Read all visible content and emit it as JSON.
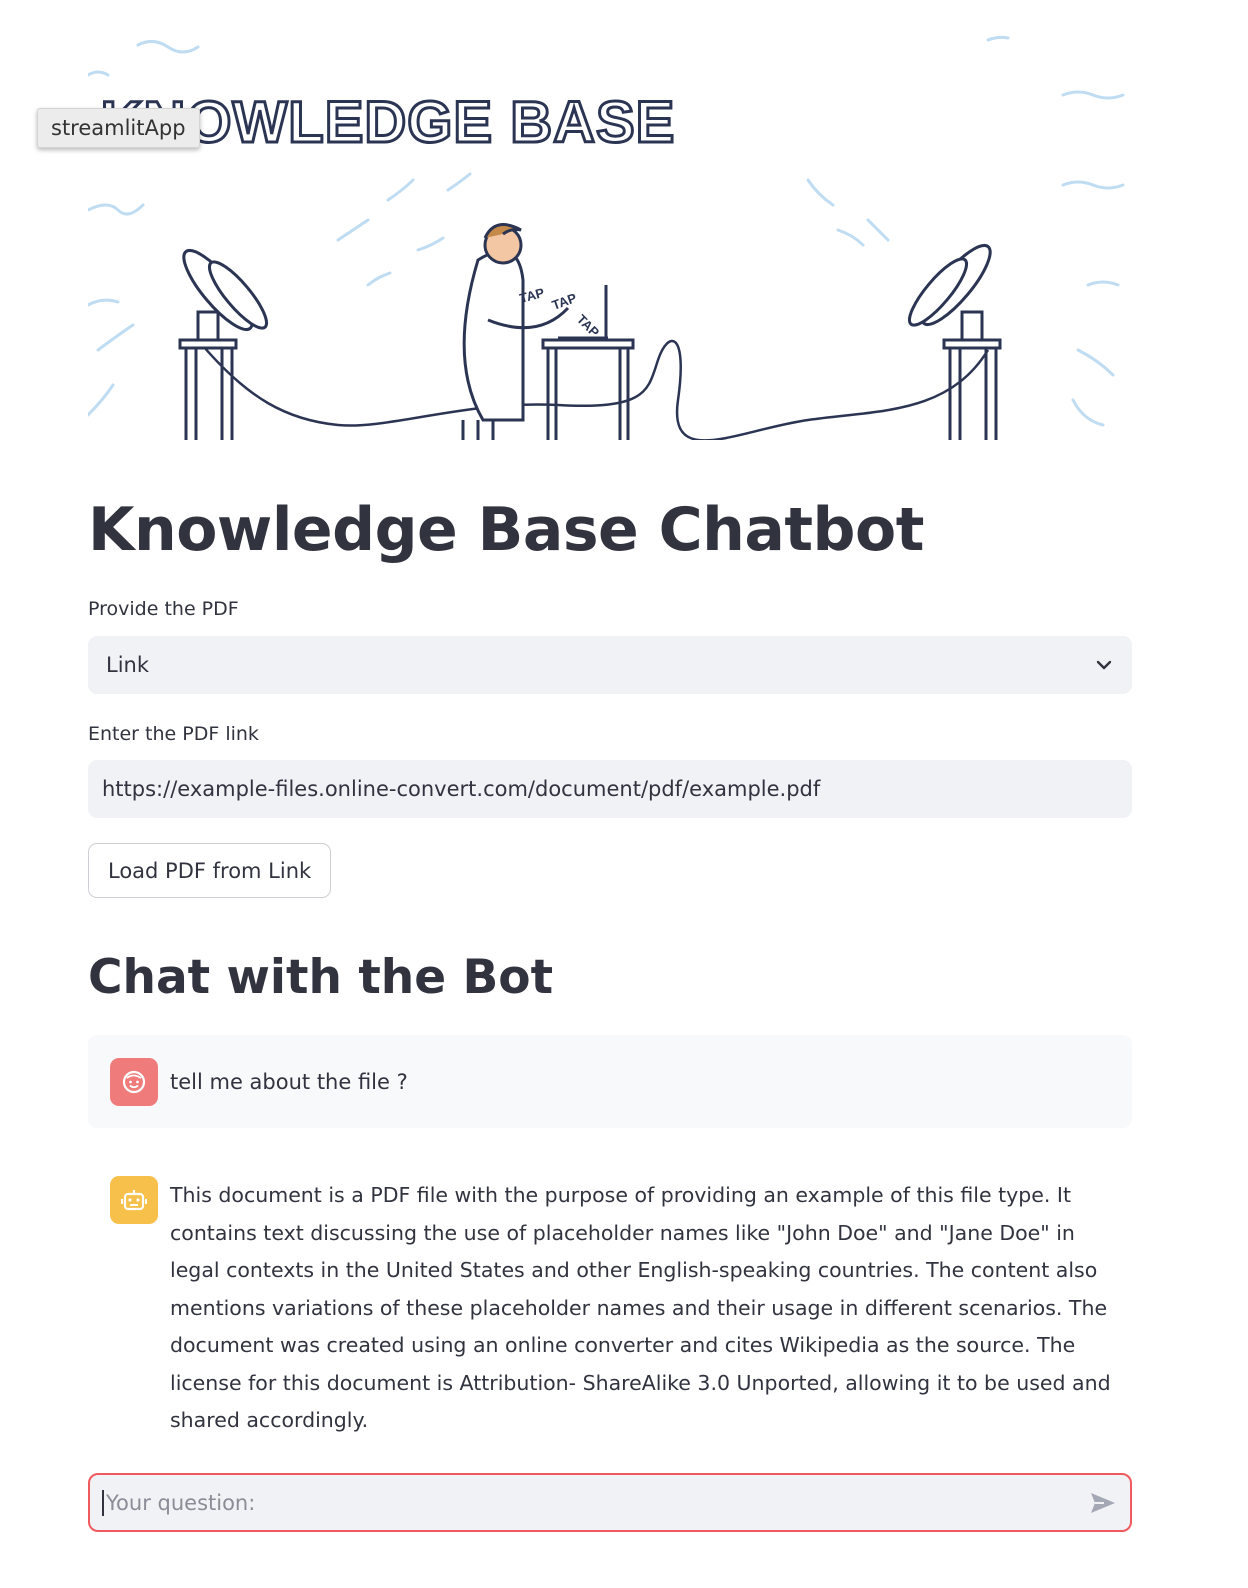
{
  "tooltip": {
    "text": "streamlitApp"
  },
  "banner": {
    "title_line": "KNOWLEDGE BASE",
    "taps": [
      "TAP",
      "TAP",
      "TAP"
    ]
  },
  "page": {
    "title": "Knowledge Base Chatbot"
  },
  "source_select": {
    "label": "Provide the PDF",
    "value": "Link"
  },
  "link_input": {
    "label": "Enter the PDF link",
    "value": "https://example-files.online-convert.com/document/pdf/example.pdf"
  },
  "load_button": {
    "label": "Load PDF from Link"
  },
  "chat": {
    "heading": "Chat with the Bot",
    "messages": [
      {
        "role": "user",
        "text": "tell me about the file ?"
      },
      {
        "role": "assistant",
        "text": "This document is a PDF file with the purpose of providing an example of this file type. It contains text discussing the use of placeholder names like \"John Doe\" and \"Jane Doe\" in legal contexts in the United States and other English-speaking countries. The content also mentions variations of these placeholder names and their usage in different scenarios. The document was created using an online converter and cites Wikipedia as the source. The license for this document is Attribution- ShareAlike 3.0 Unported, allowing it to be used and shared accordingly."
      }
    ],
    "input_placeholder": "Your question:"
  },
  "colors": {
    "text": "#31333f",
    "input_bg": "#f0f2f6",
    "user_avatar": "#f07b7b",
    "bot_avatar": "#f7c04a",
    "focus_border": "#f05a5e"
  },
  "icons": {
    "select_chevron": "chevron-down-icon",
    "user_avatar": "face-icon",
    "bot_avatar": "robot-icon",
    "send": "send-icon"
  }
}
